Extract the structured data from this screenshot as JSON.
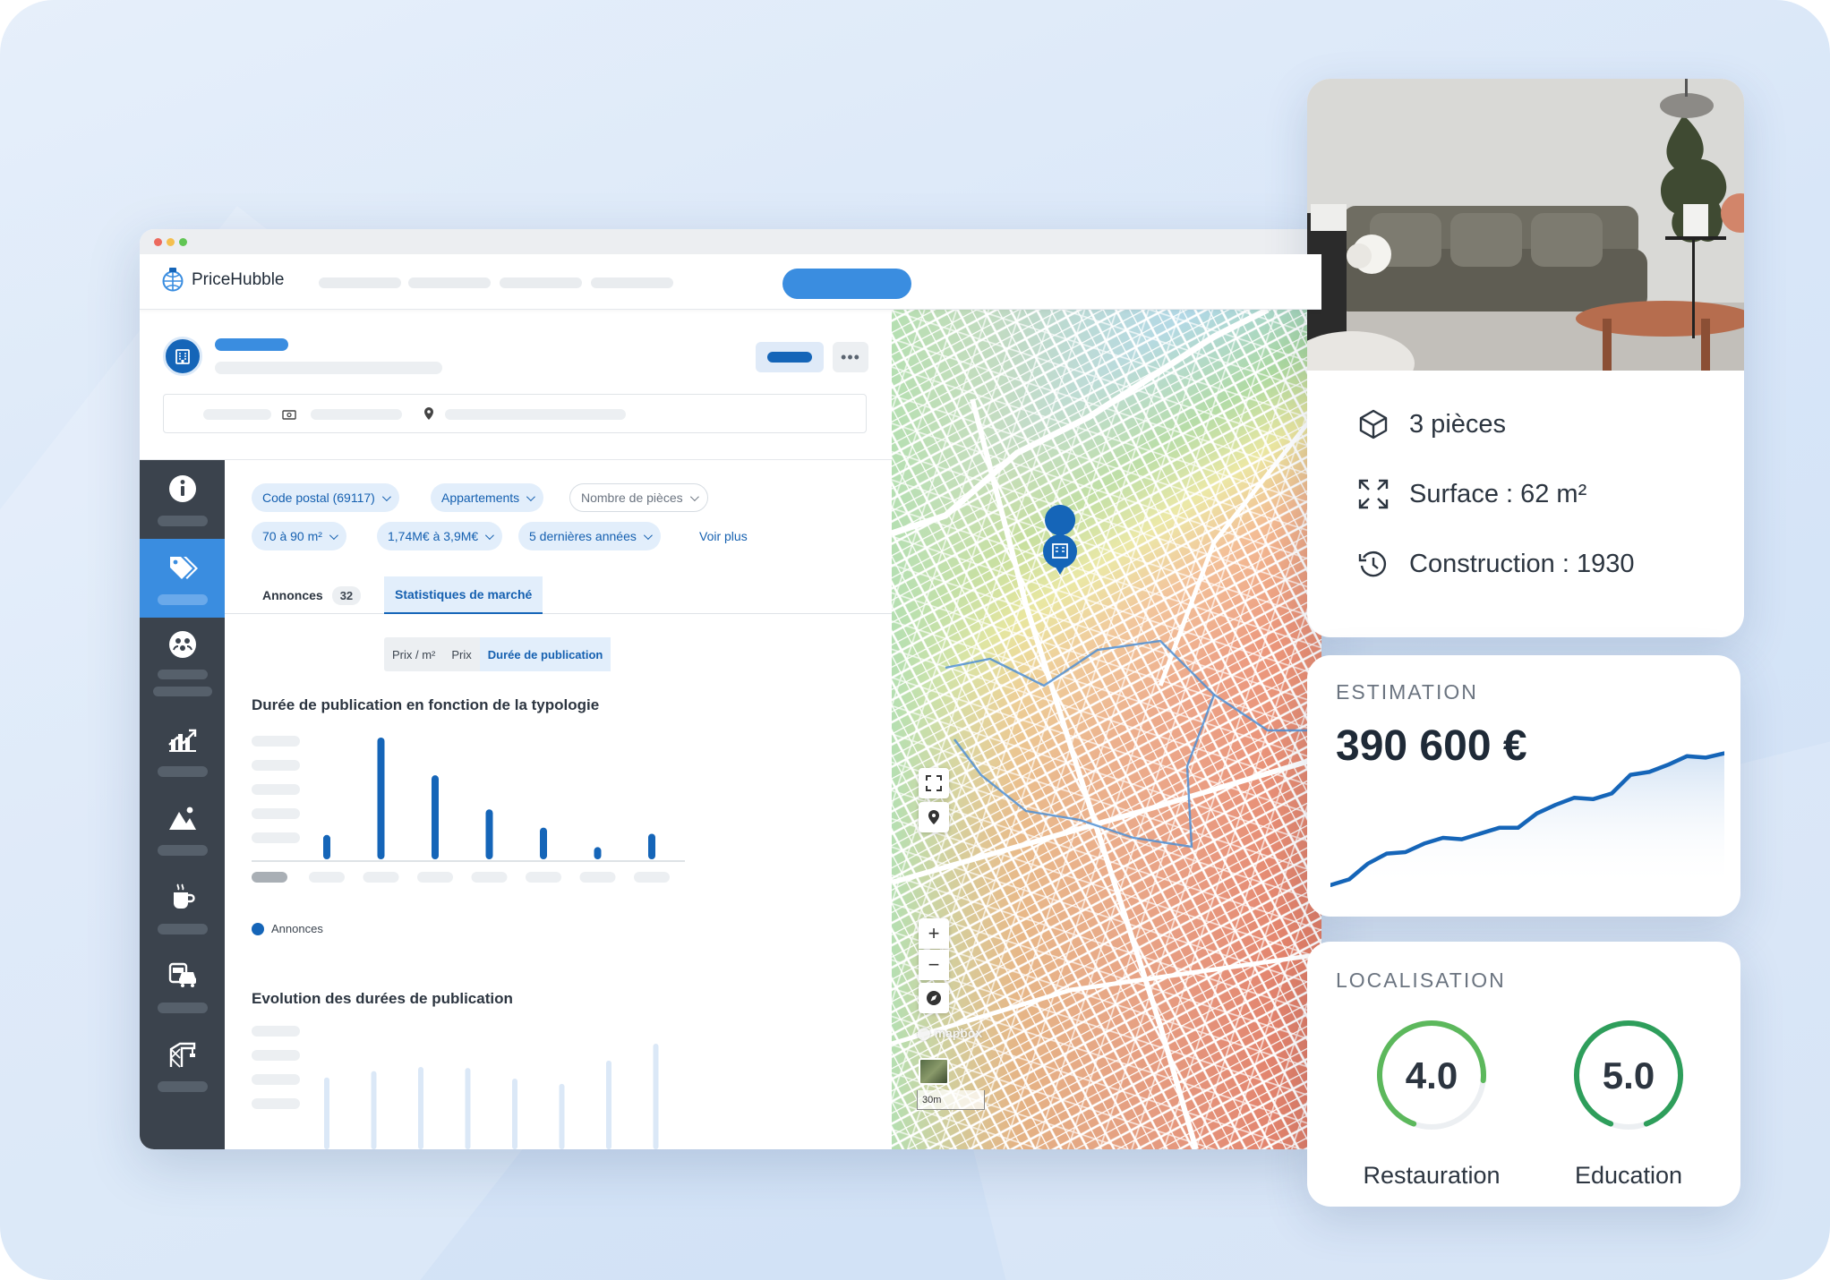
{
  "app": {
    "name": "PriceHubble"
  },
  "filters": [
    {
      "label": "Code postal (69117)",
      "style": "blue"
    },
    {
      "label": "Appartements",
      "style": "blue"
    },
    {
      "label": "Nombre de pièces",
      "style": "outline"
    },
    {
      "label": "70 à 90 m²",
      "style": "blue"
    },
    {
      "label": "1,74M€ à 3,9M€",
      "style": "blue"
    },
    {
      "label": "5 dernières années",
      "style": "blue"
    }
  ],
  "filters_more": "Voir plus",
  "tabs": [
    {
      "label": "Annonces",
      "count": "32",
      "active": false
    },
    {
      "label": "Statistiques de marché",
      "active": true
    }
  ],
  "segments": [
    {
      "label": "Prix / m²",
      "active": false
    },
    {
      "label": "Prix",
      "active": false
    },
    {
      "label": "Durée de publication",
      "active": true
    }
  ],
  "sections": {
    "chart1_title": "Durée de publication en fonction de la typologie",
    "chart2_title": "Evolution des durées de publication"
  },
  "chart_data": [
    {
      "type": "bar",
      "title": "Durée de publication en fonction de la typologie",
      "categories": [
        "",
        "",
        "",
        "",
        "",
        "",
        ""
      ],
      "series": [
        {
          "name": "Annonces",
          "values": [
            20,
            100,
            69,
            41,
            26,
            10,
            21
          ]
        }
      ],
      "ylim": [
        0,
        100
      ],
      "color": "#1565b8"
    },
    {
      "type": "bar",
      "title": "Evolution des durées de publication",
      "categories": [
        "",
        "",
        "",
        "",
        "",
        "",
        ""
      ],
      "series": [
        {
          "values": [
            68,
            74,
            78,
            77,
            67,
            62,
            84,
            100
          ]
        }
      ],
      "ylim": [
        0,
        100
      ],
      "color": "#dbe8f7"
    },
    {
      "type": "line",
      "title": "",
      "x": [
        0,
        1,
        2,
        3,
        4,
        5,
        6,
        7,
        8,
        9,
        10,
        11,
        12,
        13,
        14,
        15,
        16,
        17,
        18,
        19,
        20,
        21
      ],
      "values": [
        2,
        6,
        17,
        24,
        25,
        31,
        35,
        34,
        38,
        42,
        42,
        52,
        58,
        63,
        62,
        66,
        79,
        81,
        86,
        92,
        91,
        94
      ],
      "color": "#1565b8"
    }
  ],
  "property": {
    "rooms": "3 pièces",
    "surface": "Surface : 62 m²",
    "construction": "Construction : 1930"
  },
  "estimation": {
    "label": "ESTIMATION",
    "value": "390 600 €"
  },
  "location": {
    "label": "LOCALISATION",
    "scores": [
      {
        "value": "4.0",
        "label": "Restauration",
        "fraction": 0.8,
        "color": "#5cb85c"
      },
      {
        "value": "5.0",
        "label": "Education",
        "fraction": 1.0,
        "color": "#2e9e5b"
      }
    ]
  },
  "map": {
    "attribution": "mapbox",
    "scale": "30m"
  },
  "icons": {
    "sidebar": [
      "info-icon",
      "tag-icon",
      "community-icon",
      "chart-icon",
      "landscape-icon",
      "cafe-icon",
      "transport-icon",
      "construction-icon"
    ],
    "features": [
      "cube-icon",
      "expand-icon",
      "history-icon"
    ]
  }
}
